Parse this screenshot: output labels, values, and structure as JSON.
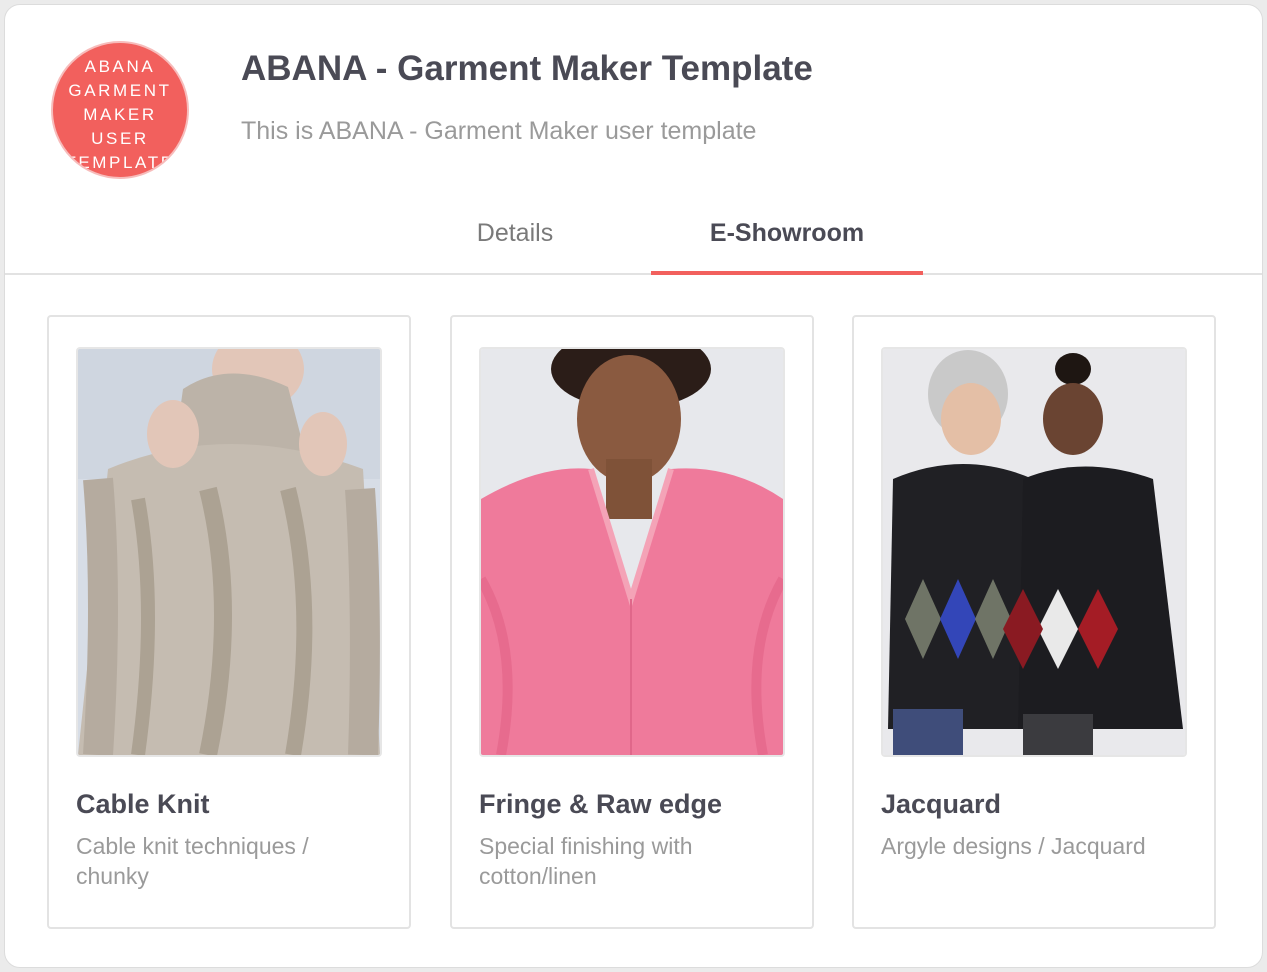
{
  "header": {
    "avatar_lines": [
      "ABANA",
      "GARMENT",
      "MAKER",
      "USER",
      "TEMPLATE"
    ],
    "title": "ABANA - Garment Maker Template",
    "subtitle": "This is ABANA - Garment Maker user template"
  },
  "tabs": [
    {
      "label": "Details",
      "active": false
    },
    {
      "label": "E-Showroom",
      "active": true
    }
  ],
  "cards": [
    {
      "title": "Cable Knit",
      "description": "Cable knit techniques / chunky",
      "image": "beige-cable-knit-sweater-photo"
    },
    {
      "title": "Fringe & Raw edge",
      "description": "Special finishing with cotton/linen",
      "image": "pink-fringe-sweater-photo"
    },
    {
      "title": "Jacquard",
      "description": "Argyle designs / Jacquard",
      "image": "argyle-jacquard-sweaters-photo"
    }
  ],
  "colors": {
    "accent": "#f2605d",
    "title_text": "#4a4a55",
    "muted_text": "#9a9a9a"
  }
}
